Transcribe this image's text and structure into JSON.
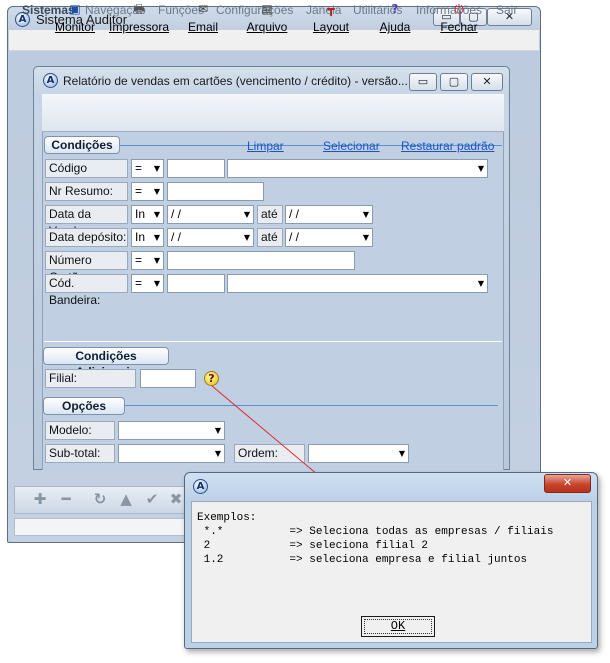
{
  "main_window": {
    "title": "Sistema Auditor",
    "caption_glyphs": {
      "minimize": "▭",
      "maximize": "▢",
      "close": "✕"
    }
  },
  "menubar": {
    "items": [
      "Sistemas",
      "Navegação",
      "Funções",
      "Configurações",
      "Janela",
      "Utilitários",
      "Informações",
      "Sair"
    ]
  },
  "inner_window": {
    "title": "Relatório de vendas em cartões (vencimento / crédito) - versão...",
    "toolbar": [
      {
        "label": "Monitor",
        "icon": "monitor-icon",
        "glyph": "▣"
      },
      {
        "label": "Impressora",
        "icon": "printer-icon",
        "glyph": "🖶"
      },
      {
        "label": "Email",
        "icon": "email-icon",
        "glyph": "✉"
      },
      {
        "label": "Arquivo",
        "icon": "file-icon",
        "glyph": "▤"
      },
      {
        "label": "Layout",
        "icon": "layout-icon",
        "glyph": "┳"
      },
      {
        "label": "Ajuda",
        "icon": "help-icon",
        "glyph": "?"
      },
      {
        "label": "Fechar",
        "icon": "close-power-icon",
        "glyph": "⏻"
      }
    ]
  },
  "conditions": {
    "header": "Condições",
    "links": {
      "clear": "Limpar",
      "select": "Selecionar",
      "restore": "Restaurar padrão"
    },
    "rows": {
      "codigo_pessoa": {
        "label": "Código pessoa:",
        "op": "="
      },
      "nr_resumo": {
        "label": "Nr Resumo:",
        "op": "="
      },
      "data_venda": {
        "label": "Data da Venda:",
        "op": "In",
        "from": " / /",
        "sep": "até",
        "to": " / /"
      },
      "data_deposito": {
        "label": "Data depósito:",
        "op": "In",
        "from": " / /",
        "sep": "até",
        "to": " / /"
      },
      "numero_cartao": {
        "label": "Número Cartão:",
        "op": "="
      },
      "cod_bandeira": {
        "label": "Cód. Bandeira:",
        "op": "="
      }
    }
  },
  "additional": {
    "header": "Condições Adicionais",
    "filial_label": "Filial:",
    "help_glyph": "?"
  },
  "options": {
    "header": "Opções",
    "modelo_label": "Modelo:",
    "subtotal_label": "Sub-total:",
    "ordem_label": "Ordem:"
  },
  "bottom_toolbar": [
    "✚",
    "━",
    "↻",
    "▲",
    "✔",
    "✖"
  ],
  "dialog": {
    "title_icon": "A",
    "lines": [
      "Exemplos:",
      " *.*          => Seleciona todas as empresas / filiais",
      " 2            => seleciona filial 2",
      " 1.2          => seleciona empresa e filial juntos"
    ],
    "ok_label": "OK"
  },
  "colors": {
    "accent_link": "#1b55c4",
    "pointer_arrow": "#e0282d",
    "close_button": "#c9442c"
  }
}
